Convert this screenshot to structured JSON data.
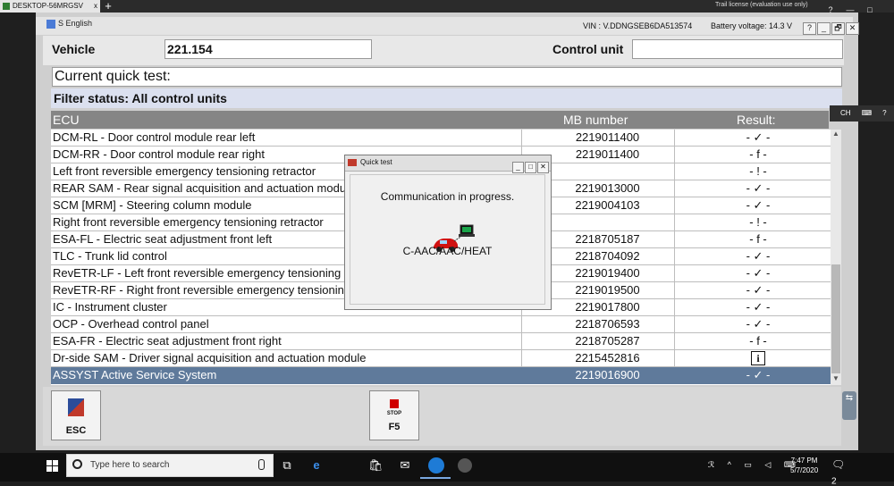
{
  "remote": {
    "tab_label": "DESKTOP-56MRGSV",
    "tab_close": "x",
    "add": "+",
    "trial_text": "Trail license (evaluation use only)",
    "ctrls": [
      "?",
      "—",
      "□",
      "✕"
    ]
  },
  "app": {
    "lang": "S English",
    "vin": "VIN : V.DDNGSEB6DA513574",
    "battery": "Battery voltage: 14.3 V",
    "window_ctrls": [
      "?",
      "_",
      "🗗",
      "✕"
    ]
  },
  "header": {
    "vehicle_label": "Vehicle",
    "vehicle_value": "221.154",
    "control_label": "Control unit",
    "control_value": ""
  },
  "quick_test": "Current quick test:",
  "filter_status": "Filter status: All control units",
  "table": {
    "columns": [
      "ECU",
      "MB number",
      "Result:"
    ],
    "rows": [
      {
        "ecu": "DCM-RL - Door control module rear left",
        "mb": "2219011400",
        "result": "- ✓ -"
      },
      {
        "ecu": "DCM-RR - Door control module rear right",
        "mb": "2219011400",
        "result": "- f -"
      },
      {
        "ecu": "Left front reversible emergency tensioning retractor",
        "mb": "",
        "result": "- ! -"
      },
      {
        "ecu": "REAR SAM - Rear signal acquisition and actuation module",
        "mb": "2219013000",
        "result": "- ✓ -"
      },
      {
        "ecu": "SCM [MRM] - Steering column module",
        "mb": "2219004103",
        "result": "- ✓ -"
      },
      {
        "ecu": "Right front reversible emergency tensioning retractor",
        "mb": "",
        "result": "- ! -"
      },
      {
        "ecu": "ESA-FL - Electric seat adjustment front left",
        "mb": "2218705187",
        "result": "- f -"
      },
      {
        "ecu": "TLC - Trunk lid control",
        "mb": "2218704092",
        "result": "- ✓ -"
      },
      {
        "ecu": "RevETR-LF - Left front reversible emergency tensioning r",
        "mb": "2219019400",
        "result": "- ✓ -"
      },
      {
        "ecu": "RevETR-RF - Right front reversible emergency tensioning",
        "mb": "2219019500",
        "result": "- ✓ -"
      },
      {
        "ecu": "IC - Instrument cluster",
        "mb": "2219017800",
        "result": "- ✓ -"
      },
      {
        "ecu": "OCP - Overhead control panel",
        "mb": "2218706593",
        "result": "- ✓ -"
      },
      {
        "ecu": "ESA-FR - Electric seat adjustment front right",
        "mb": "2218705287",
        "result": "- f -"
      },
      {
        "ecu": "Dr-side SAM - Driver signal acquisition and actuation module",
        "mb": "2215452816",
        "result": "i"
      },
      {
        "ecu": "ASSYST Active Service System",
        "mb": "2219016900",
        "result": "- ✓ -"
      }
    ],
    "selected_index": 14
  },
  "buttons": {
    "esc_label": "ESC",
    "stop_small": "STOP",
    "stop_label": "F5"
  },
  "side": {
    "strip_items": [
      "CH",
      "⌨",
      "?",
      "▾"
    ],
    "side_tab": "⇆"
  },
  "dialog": {
    "title": "Quick test",
    "ctrls": [
      "_",
      "□",
      "✕"
    ],
    "message": "Communication in progress.",
    "ecu": "C-AAC/AAC/HEAT"
  },
  "taskbar": {
    "search_placeholder": "Type here to search",
    "time": "7:47 PM",
    "date": "5/7/2020",
    "tray": "ℛ ^ ▭ ◁ ⌨",
    "notify": "2"
  }
}
